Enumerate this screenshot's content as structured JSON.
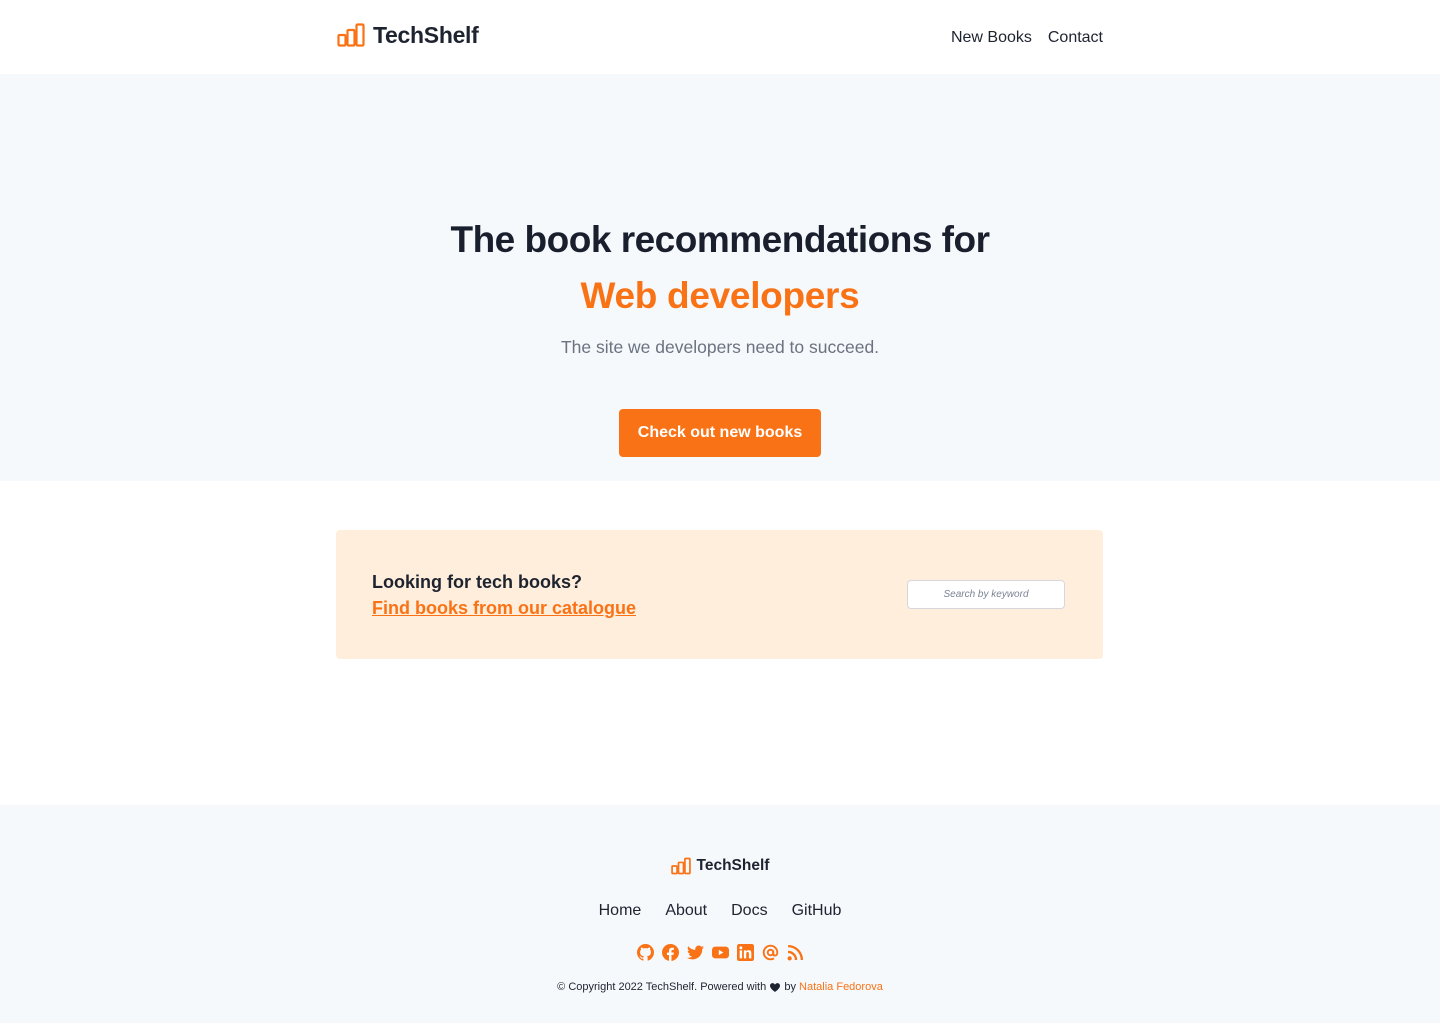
{
  "header": {
    "brand": "TechShelf",
    "nav": [
      {
        "label": "New Books"
      },
      {
        "label": "Contact"
      }
    ]
  },
  "hero": {
    "title": "The book recommendations for",
    "accent": "Web developers",
    "subtitle": "The site we developers need to succeed.",
    "cta_label": "Check out new books"
  },
  "search": {
    "heading": "Looking for tech books?",
    "link": "Find books from our catalogue",
    "placeholder": "Search by keyword"
  },
  "footer": {
    "brand": "TechShelf",
    "nav": [
      {
        "label": "Home"
      },
      {
        "label": "About"
      },
      {
        "label": "Docs"
      },
      {
        "label": "GitHub"
      }
    ],
    "socials": [
      "github-icon",
      "facebook-icon",
      "twitter-icon",
      "youtube-icon",
      "linkedin-icon",
      "email-icon",
      "rss-icon"
    ],
    "copyright_prefix": "© Copyright 2022 TechShelf. Powered with",
    "copyright_by": "by",
    "author": "Natalia Fedorova"
  },
  "colors": {
    "accent": "#f97316",
    "hero_bg": "#f6f9fc",
    "card_bg": "#feeedb",
    "text_dark": "#1e2330",
    "text_muted": "#6b7280"
  }
}
